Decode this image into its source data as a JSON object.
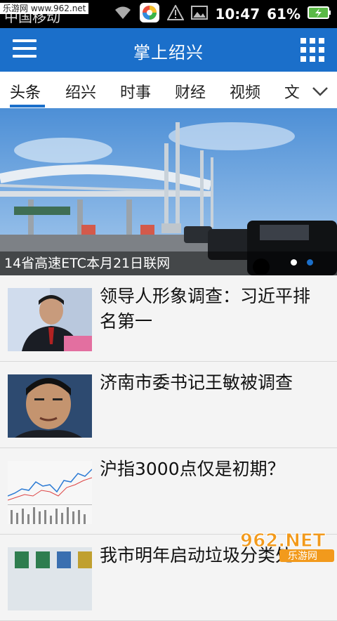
{
  "status_bar": {
    "watermark": "乐游网 www.962.net",
    "carrier": "中国移动",
    "time": "10:47",
    "battery": "61%"
  },
  "header": {
    "title": "掌上绍兴"
  },
  "tabs": [
    "头条",
    "绍兴",
    "时事",
    "财经",
    "视频",
    "文"
  ],
  "banner": {
    "caption": "14省高速ETC本月21日联网",
    "slide_count": 2,
    "active_slide": 2
  },
  "news": [
    {
      "title": "领导人形象调查：习近平排名第一"
    },
    {
      "title": "济南市委书记王敏被调查"
    },
    {
      "title": "沪指3000点仅是初期？"
    },
    {
      "title": "我市明年启动垃圾分类处"
    }
  ],
  "footer_logo": {
    "text": "962.NET",
    "subtext": "乐游网"
  },
  "colors": {
    "accent": "#1b6fca",
    "status_bar": "#000000"
  }
}
